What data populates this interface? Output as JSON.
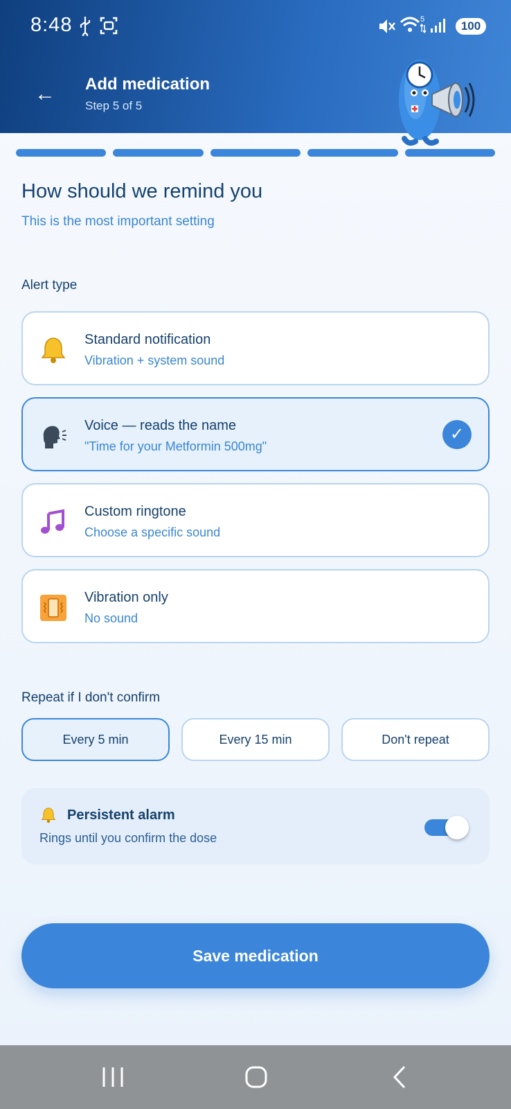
{
  "status_bar": {
    "time": "8:48",
    "battery": "100",
    "network_label": "5"
  },
  "header": {
    "title": "Add medication",
    "step": "Step 5 of 5",
    "progress": {
      "current_step": 5,
      "total_steps": 5
    }
  },
  "main": {
    "heading": "How should we remind you",
    "subheading": "This is the most important setting",
    "alert_type_label": "Alert type",
    "alert_options": [
      {
        "icon": "bell-icon",
        "title": "Standard notification",
        "desc": "Vibration + system sound",
        "selected": false
      },
      {
        "icon": "speaking-head-icon",
        "title": "Voice — reads the name",
        "desc": "\"Time for your Metformin 500mg\"",
        "selected": true
      },
      {
        "icon": "music-note-icon",
        "title": "Custom ringtone",
        "desc": "Choose a specific sound",
        "selected": false
      },
      {
        "icon": "vibration-icon",
        "title": "Vibration only",
        "desc": "No sound",
        "selected": false
      }
    ],
    "repeat_label": "Repeat if I don't confirm",
    "repeat_options": [
      "Every 5 min",
      "Every 15 min",
      "Don't repeat"
    ],
    "repeat_selected": "Every 5 min",
    "persistent": {
      "title": "Persistent alarm",
      "desc": "Rings until you confirm the dose",
      "enabled": true
    },
    "save_label": "Save medication"
  },
  "colors": {
    "accent": "#3b86da",
    "header_dark": "#0f3f7e",
    "text_dark": "#16406b",
    "text_link": "#3a86d4"
  }
}
